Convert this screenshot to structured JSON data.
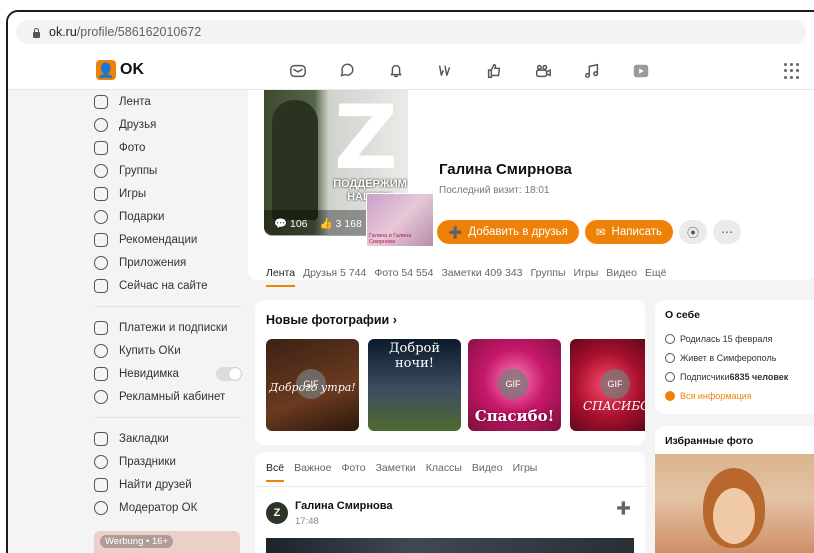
{
  "browser": {
    "url_host": "ok.ru",
    "url_path": "/profile/586162010672"
  },
  "header": {
    "logo_text": "OK",
    "logo_symbol": "ok-logo",
    "nav_icons": [
      "mail-icon",
      "chat-icon",
      "bell-icon",
      "guests-icon",
      "like-icon",
      "video-call-icon",
      "music-icon",
      "video-icon"
    ]
  },
  "sidebar": {
    "items": [
      {
        "label": "Лента",
        "icon": "home-icon"
      },
      {
        "label": "Друзья",
        "icon": "friends-icon"
      },
      {
        "label": "Фото",
        "icon": "photo-icon"
      },
      {
        "label": "Группы",
        "icon": "groups-icon"
      },
      {
        "label": "Игры",
        "icon": "games-icon"
      },
      {
        "label": "Подарки",
        "icon": "gift-icon"
      },
      {
        "label": "Рекомендации",
        "icon": "compass-icon"
      },
      {
        "label": "Приложения",
        "icon": "apps-icon"
      },
      {
        "label": "Сейчас на сайте",
        "icon": "online-icon"
      }
    ],
    "items2": [
      {
        "label": "Платежи и подписки",
        "icon": "wallet-icon"
      },
      {
        "label": "Купить ОКи",
        "icon": "coin-icon"
      },
      {
        "label": "Невидимка",
        "icon": "invisible-icon"
      },
      {
        "label": "Рекламный кабинет",
        "icon": "megaphone-icon"
      }
    ],
    "items3": [
      {
        "label": "Закладки",
        "icon": "bookmark-icon"
      },
      {
        "label": "Праздники",
        "icon": "holiday-icon"
      },
      {
        "label": "Найти друзей",
        "icon": "find-friends-icon"
      },
      {
        "label": "Модератор ОК",
        "icon": "moderator-icon"
      }
    ],
    "ad_label": "Werbung • 16+"
  },
  "profile": {
    "name": "Галина Смирнова",
    "last_visit": "Последний визит: 18:01",
    "avatar_letter": "Z",
    "avatar_slogan": "ПОДДЕРЖИМ НАШИХ!",
    "stat_comments": "106",
    "stat_likes": "3 168",
    "thumb_caption": "Галина и Галина Смирнова",
    "add_friend_label": "Добавить в друзья",
    "write_label": "Написать",
    "tabs": [
      "Лента",
      "Друзья 5 744",
      "Фото 54 554",
      "Заметки 409 343",
      "Группы",
      "Игры",
      "Видео",
      "Ещё"
    ]
  },
  "new_photos": {
    "title": "Новые фотографии",
    "items": [
      {
        "caption": "Доброго утра!",
        "gif": "GIF"
      },
      {
        "caption": "Доброй ночи!",
        "gif": ""
      },
      {
        "caption": "Спасибо!",
        "gif": "GIF"
      },
      {
        "caption": "СПАСИБО",
        "gif": "GIF"
      }
    ]
  },
  "feed": {
    "tabs": [
      "Всё",
      "Важное",
      "Фото",
      "Заметки",
      "Классы",
      "Видео",
      "Игры"
    ],
    "post_author": "Галина Смирнова",
    "post_time": "17:48"
  },
  "about": {
    "title": "О себе",
    "birthday": "Родилась 15 февраля",
    "city": "Живет в Симферополь",
    "subscribers_prefix": "Подписчики ",
    "subscribers_count": "6835 человек",
    "all_info": "Вся информация"
  },
  "favorites": {
    "title": "Избранные фото"
  },
  "colors": {
    "accent": "#ee8208"
  }
}
